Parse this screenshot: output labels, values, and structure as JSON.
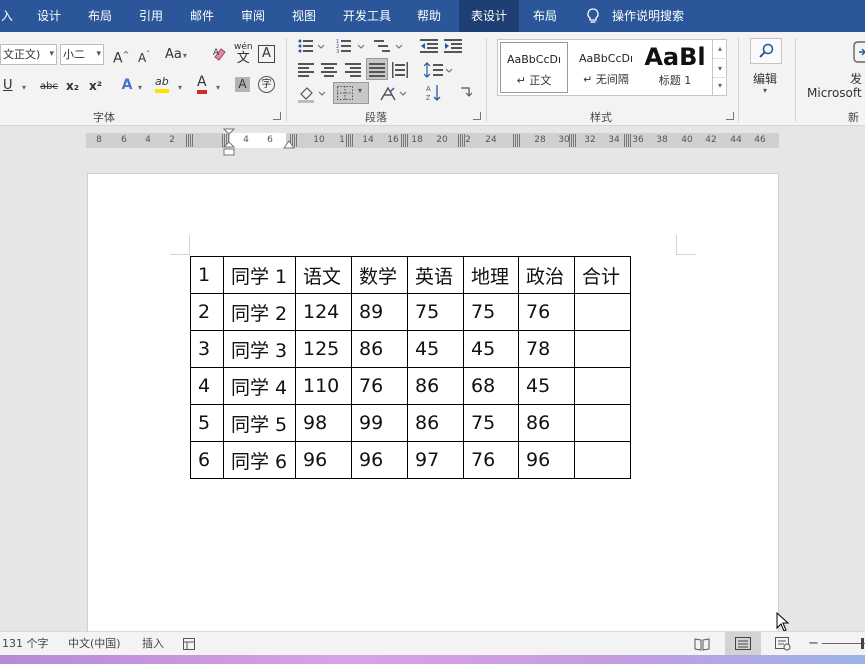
{
  "menu": {
    "tabs": [
      {
        "label": "入",
        "key": "insert"
      },
      {
        "label": "设计",
        "key": "design"
      },
      {
        "label": "布局",
        "key": "layout"
      },
      {
        "label": "引用",
        "key": "references"
      },
      {
        "label": "邮件",
        "key": "mailings"
      },
      {
        "label": "审阅",
        "key": "review"
      },
      {
        "label": "视图",
        "key": "view"
      },
      {
        "label": "开发工具",
        "key": "developer"
      },
      {
        "label": "帮助",
        "key": "help"
      },
      {
        "label": "表设计",
        "key": "table-design"
      },
      {
        "label": "布局",
        "key": "table-layout"
      }
    ],
    "tell_me": "操作说明搜索",
    "selected_tab": "表设计"
  },
  "ribbon": {
    "font_group": {
      "font_name": "文正文)",
      "font_size": "小二",
      "label": "字体",
      "grow": "A",
      "shrink": "A",
      "change_case": "Aa",
      "phonetic": "wén",
      "char_border": "A",
      "underline": "U",
      "strike": "abc",
      "subscript": "x₂",
      "superscript": "x²",
      "text_effects": "A",
      "highlight": "ab",
      "font_color": "A",
      "char_shading": "A",
      "enclose": "字"
    },
    "paragraph_group": {
      "label": "段落"
    },
    "styles_group": {
      "label": "样式",
      "items": [
        {
          "preview": "AaBbCcDı",
          "name": "↵ 正文"
        },
        {
          "preview": "AaBbCcDı",
          "name": "↵ 无间隔"
        },
        {
          "preview": "AaBl",
          "name": "标题 1"
        }
      ]
    },
    "editing": {
      "label": "编辑"
    },
    "new_group": {
      "partial_label": "发",
      "partial_label2": "Microsoft",
      "label": "新建"
    }
  },
  "ruler": {
    "left_numbers": [
      "8",
      "6",
      "4",
      "2"
    ],
    "white_numbers": [
      "2",
      "4",
      "6"
    ],
    "right_numbers": [
      "10",
      "1",
      "14",
      "16",
      "18",
      "20",
      "2",
      "24",
      "28",
      "30",
      "32",
      "34",
      "36",
      "38",
      "40",
      "42",
      "44",
      "46"
    ]
  },
  "table": {
    "rows": [
      [
        "1",
        "同学 1",
        "语文",
        "数学",
        "英语",
        "地理",
        "政治",
        "合计"
      ],
      [
        "2",
        "同学 2",
        "124",
        "89",
        "75",
        "75",
        "76",
        ""
      ],
      [
        "3",
        "同学 3",
        "125",
        "86",
        "45",
        "45",
        "78",
        ""
      ],
      [
        "4",
        "同学 4",
        "110",
        "76",
        "86",
        "68",
        "45",
        ""
      ],
      [
        "5",
        "同学 5",
        "98",
        "99",
        "86",
        "75",
        "86",
        ""
      ],
      [
        "6",
        "同学 6",
        "96",
        "96",
        "97",
        "76",
        "96",
        ""
      ]
    ]
  },
  "status": {
    "word_count": "131 个字",
    "language": "中文(中国)",
    "mode": "插入",
    "zoom_minus": "−"
  },
  "colors": {
    "menu_bg": "#2b579a",
    "menu_selected": "#1e3f73",
    "ribbon_bg": "#f3f3f3",
    "highlight_yellow": "#ffe100",
    "font_color_red": "#d22b2b"
  }
}
